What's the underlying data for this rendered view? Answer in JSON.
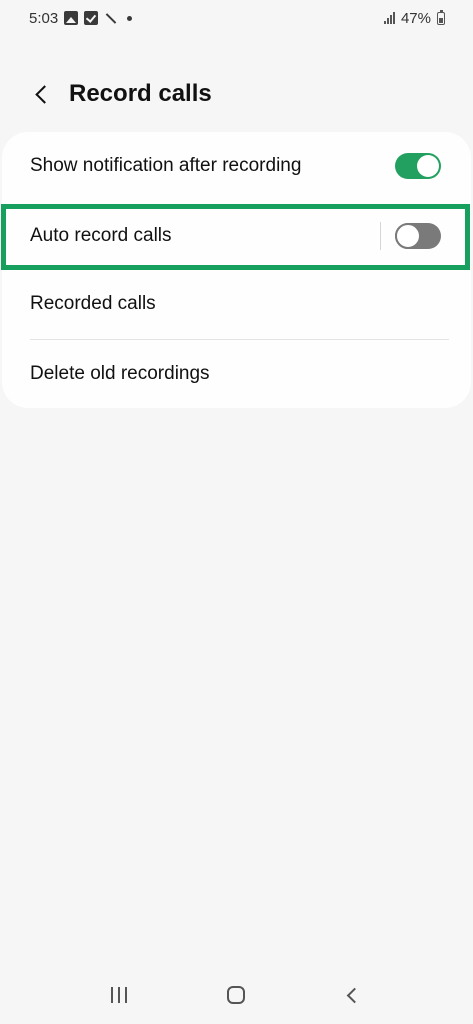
{
  "status_bar": {
    "time": "5:03",
    "battery_percent": "47%",
    "icons": [
      "gallery-icon",
      "checkbox-icon",
      "magic-wand-icon",
      "dot-icon",
      "signal-icon",
      "battery-icon"
    ]
  },
  "header": {
    "title": "Record calls",
    "back_icon": "chevron-left-icon"
  },
  "settings": {
    "items": [
      {
        "label": "Show notification after recording",
        "toggle": true
      },
      {
        "label": "Auto record calls",
        "toggle": false
      },
      {
        "label": "Recorded calls"
      },
      {
        "label": "Delete old recordings"
      }
    ]
  },
  "colors": {
    "accent": "#22a060",
    "highlight": "#17a05d",
    "toggle_off": "#7a7a7a",
    "background": "#f6f6f6",
    "card": "#fefefe"
  },
  "nav_bar": {
    "icons": [
      "recents-icon",
      "home-icon",
      "back-icon"
    ]
  }
}
